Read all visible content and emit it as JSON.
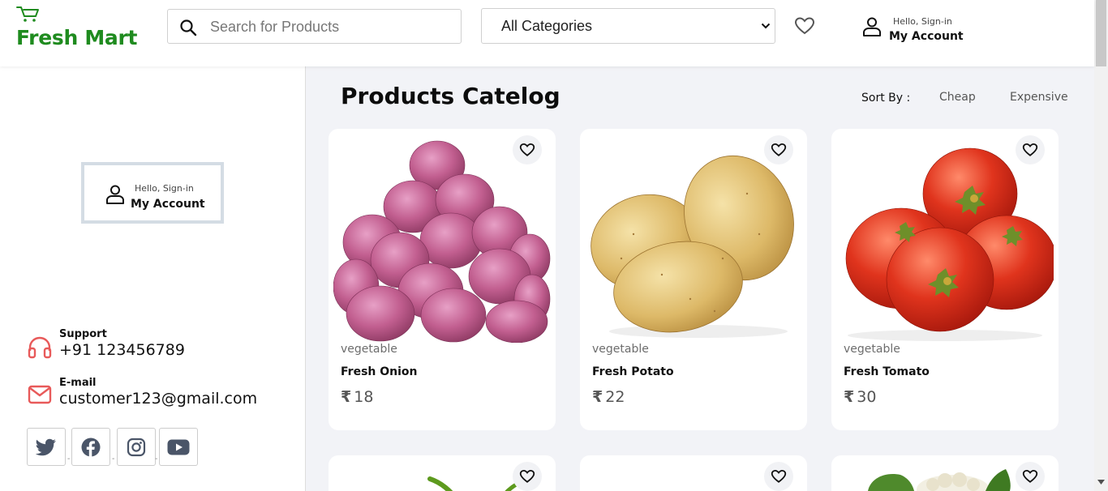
{
  "header": {
    "logo_text": "Fresh Mart",
    "search_placeholder": "Search for Products",
    "category_selected": "All Categories",
    "account_hello": "Hello, Sign-in",
    "account_label": "My Account"
  },
  "sidebar": {
    "account_hello": "Hello, Sign-in",
    "account_label": "My Account",
    "support_label": "Support",
    "support_value": "+91 123456789",
    "email_label": "E-mail",
    "email_value": "customer123@gmail.com",
    "socials": [
      "twitter-icon",
      "facebook-icon",
      "instagram-icon",
      "youtube-icon"
    ]
  },
  "main": {
    "title": "Products Catelog",
    "sort_label": "Sort By :",
    "sort_options": [
      "Cheap",
      "Expensive"
    ],
    "currency_symbol": "₹",
    "products": [
      {
        "category": "vegetable",
        "name": "Fresh Onion",
        "price": "18"
      },
      {
        "category": "vegetable",
        "name": "Fresh Potato",
        "price": "22"
      },
      {
        "category": "vegetable",
        "name": "Fresh Tomato",
        "price": "30"
      }
    ]
  },
  "colors": {
    "brand_green": "#1f8b1f",
    "accent_red": "#e85a5a",
    "page_bg": "#f2f3f7"
  }
}
